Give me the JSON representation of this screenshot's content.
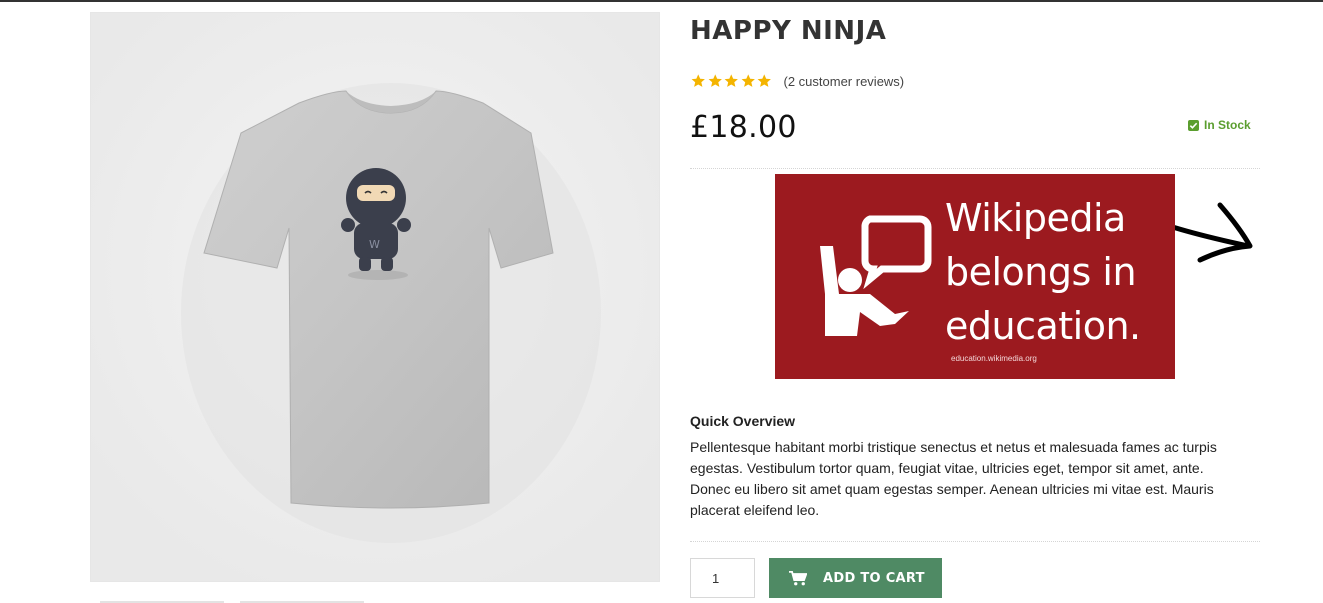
{
  "product": {
    "title": "HAPPY NINJA",
    "rating_stars": 5,
    "reviews_label": "(2 customer reviews)",
    "price": "£18.00",
    "stock_label": "In Stock",
    "image_icon": "ninja-tshirt-image"
  },
  "banner": {
    "line1": "Wikipedia",
    "line2": "belongs in",
    "line3": "education.",
    "url": "education.wikimedia.org"
  },
  "overview": {
    "heading": "Quick Overview",
    "text": "Pellentesque habitant morbi tristique senectus et netus et malesuada fames ac turpis egestas. Vestibulum tortor quam, feugiat vitae, ultricies eget, tempor sit amet, ante. Donec eu libero sit amet quam egestas semper. Aenean ultricies mi vitae est. Mauris placerat eleifend leo."
  },
  "cart": {
    "quantity": "1",
    "add_label": "ADD TO CART"
  },
  "colors": {
    "accent_button": "#4f8a64",
    "stock_green": "#5b9e2f",
    "star_gold": "#f4b400",
    "banner_red": "#9c1a1f"
  }
}
